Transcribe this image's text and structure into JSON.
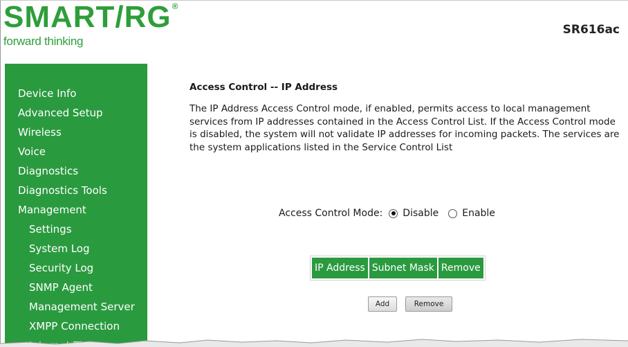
{
  "brand": {
    "logo_text": "SMART/RG",
    "logo_mark": "®",
    "tagline": "forward thinking",
    "model": "SR616ac",
    "colors": {
      "green": "#2a9a3f",
      "logo_green": "#2e9e3a"
    }
  },
  "sidebar": {
    "items": [
      {
        "label": "Device Info",
        "level": "top"
      },
      {
        "label": "Advanced Setup",
        "level": "top"
      },
      {
        "label": "Wireless",
        "level": "top"
      },
      {
        "label": "Voice",
        "level": "top"
      },
      {
        "label": "Diagnostics",
        "level": "top"
      },
      {
        "label": "Diagnostics Tools",
        "level": "top"
      },
      {
        "label": "Management",
        "level": "top"
      },
      {
        "label": "Settings",
        "level": "sub"
      },
      {
        "label": "System Log",
        "level": "sub"
      },
      {
        "label": "Security Log",
        "level": "sub"
      },
      {
        "label": "SNMP Agent",
        "level": "sub"
      },
      {
        "label": "Management Server",
        "level": "sub"
      },
      {
        "label": "XMPP Connection",
        "level": "sub"
      },
      {
        "label": "Internet Time",
        "level": "sub"
      }
    ]
  },
  "main": {
    "title": "Access Control -- IP Address",
    "description": "The IP Address Access Control mode, if enabled, permits access to local management services from IP addresses contained in the Access Control List. If the Access Control mode is disabled, the system will not validate IP addresses for incoming packets. The services are the system applications listed in the Service Control List",
    "mode": {
      "label": "Access Control Mode:",
      "options": [
        {
          "label": "Disable",
          "selected": true
        },
        {
          "label": "Enable",
          "selected": false
        }
      ]
    },
    "table": {
      "headers": [
        "IP Address",
        "Subnet Mask",
        "Remove"
      ],
      "rows": []
    },
    "buttons": {
      "add": "Add",
      "remove": "Remove"
    }
  }
}
